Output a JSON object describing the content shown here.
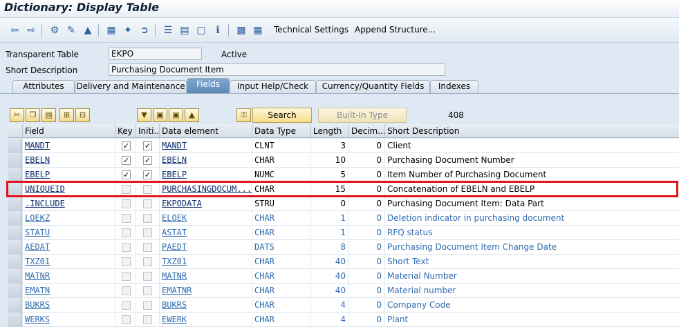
{
  "window": {
    "title": "Dictionary: Display Table"
  },
  "toolbar": {
    "icons": [
      "back-icon",
      "forward-icon",
      "other-object-icon",
      "display-change-icon",
      "activate-icon",
      "where-used-icon",
      "object-list-icon",
      "navigate-icon",
      "hierarchy-icon",
      "documentation-icon",
      "info-icon",
      "table-view-icon",
      "grid-icon"
    ],
    "technical_settings": "Technical Settings",
    "append_structure": "Append Structure..."
  },
  "header": {
    "table_label": "Transparent Table",
    "table_value": "EKPO",
    "status": "Active",
    "desc_label": "Short Description",
    "desc_value": "Purchasing Document Item"
  },
  "tabs": [
    "Attributes",
    "Delivery and Maintenance",
    "Fields",
    "Input Help/Check",
    "Currency/Quantity Fields",
    "Indexes"
  ],
  "active_tab": "Fields",
  "table_toolbar": {
    "search_label": "Search",
    "builtin_label": "Built-In Type",
    "count": "408"
  },
  "columns": [
    "Field",
    "Key",
    "Initi...",
    "Data element",
    "Data Type",
    "Length",
    "Decim...",
    "Short Description"
  ],
  "rows": [
    {
      "field": "MANDT",
      "key": true,
      "init": true,
      "elem": "MANDT",
      "type": "CLNT",
      "len": "3",
      "dec": "0",
      "desc": "Client",
      "editable": false
    },
    {
      "field": "EBELN",
      "key": true,
      "init": true,
      "elem": "EBELN",
      "type": "CHAR",
      "len": "10",
      "dec": "0",
      "desc": "Purchasing Document Number",
      "editable": false
    },
    {
      "field": "EBELP",
      "key": true,
      "init": true,
      "elem": "EBELP",
      "type": "NUMC",
      "len": "5",
      "dec": "0",
      "desc": "Item Number of Purchasing Document",
      "editable": false
    },
    {
      "field": "UNIQUEID",
      "key": false,
      "init": false,
      "elem": "PURCHASINGDOCUM...",
      "type": "CHAR",
      "len": "15",
      "dec": "0",
      "desc": "Concatenation of EBELN and EBELP",
      "editable": false
    },
    {
      "field": ".INCLUDE",
      "key": false,
      "init": false,
      "elem": "EKPODATA",
      "type": "STRU",
      "len": "0",
      "dec": "0",
      "desc": "Purchasing Document Item: Data Part",
      "editable": false
    },
    {
      "field": "LOEKZ",
      "key": false,
      "init": false,
      "elem": "ELOEK",
      "type": "CHAR",
      "len": "1",
      "dec": "0",
      "desc": "Deletion indicator in purchasing document",
      "editable": true
    },
    {
      "field": "STATU",
      "key": false,
      "init": false,
      "elem": "ASTAT",
      "type": "CHAR",
      "len": "1",
      "dec": "0",
      "desc": "RFQ status",
      "editable": true
    },
    {
      "field": "AEDAT",
      "key": false,
      "init": false,
      "elem": "PAEDT",
      "type": "DATS",
      "len": "8",
      "dec": "0",
      "desc": "Purchasing Document Item Change Date",
      "editable": true
    },
    {
      "field": "TXZ01",
      "key": false,
      "init": false,
      "elem": "TXZ01",
      "type": "CHAR",
      "len": "40",
      "dec": "0",
      "desc": "Short Text",
      "editable": true
    },
    {
      "field": "MATNR",
      "key": false,
      "init": false,
      "elem": "MATNR",
      "type": "CHAR",
      "len": "40",
      "dec": "0",
      "desc": "Material Number",
      "editable": true
    },
    {
      "field": "EMATN",
      "key": false,
      "init": false,
      "elem": "EMATNR",
      "type": "CHAR",
      "len": "40",
      "dec": "0",
      "desc": "Material number",
      "editable": true
    },
    {
      "field": "BUKRS",
      "key": false,
      "init": false,
      "elem": "BUKRS",
      "type": "CHAR",
      "len": "4",
      "dec": "0",
      "desc": "Company Code",
      "editable": true
    },
    {
      "field": "WERKS",
      "key": false,
      "init": false,
      "elem": "EWERK",
      "type": "CHAR",
      "len": "4",
      "dec": "0",
      "desc": "Plant",
      "editable": true
    }
  ],
  "colors": {
    "highlight": "#e1141b",
    "active_tab": "#5d89b6",
    "blue_text": "#2d6bb0"
  }
}
